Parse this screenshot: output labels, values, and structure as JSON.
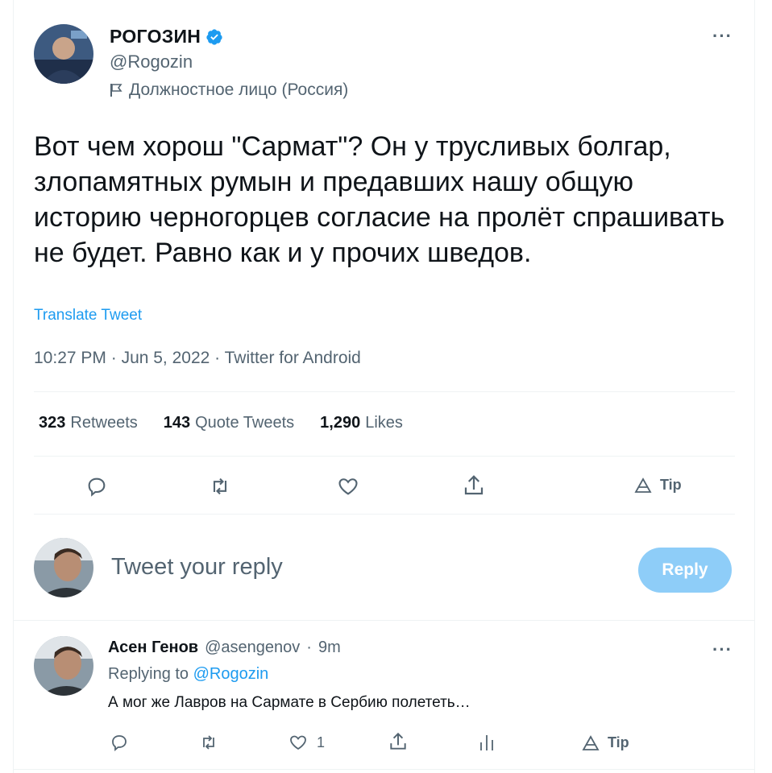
{
  "tweet": {
    "author_name": "РОГОЗИН",
    "author_handle": "@Rogozin",
    "label": "Должностное лицо (Россия)",
    "text": "Вот чем хорош \"Сармат\"? Он у трусливых болгар, злопамятных румын и предавших нашу общую историю черногорцев согласие на пролёт спрашивать не будет. Равно как и у прочих шведов.",
    "translate_label": "Translate Tweet",
    "time": "10:27 PM",
    "date": "Jun 5, 2022",
    "source": "Twitter for Android",
    "separator": " · ",
    "stats": {
      "retweets_count": "323",
      "retweets_label": "Retweets",
      "quote_count": "143",
      "quote_label": "Quote Tweets",
      "likes_count": "1,290",
      "likes_label": "Likes"
    },
    "actions": {
      "tip_label": "Tip"
    }
  },
  "compose": {
    "placeholder": "Tweet your reply",
    "button_label": "Reply"
  },
  "reply": {
    "author_name": "Асен Генов",
    "author_handle": "@asengenov",
    "time": "9m",
    "replying_prefix": "Replying to",
    "replying_to": "@Rogozin",
    "text": "А мог же Лавров на Сармате в Сербию полететь…",
    "like_count": "1",
    "tip_label": "Tip"
  },
  "icons": {
    "more": "more-icon",
    "verified": "verified-badge-icon",
    "flag": "flag-icon",
    "reply": "reply-icon",
    "retweet": "retweet-icon",
    "like": "heart-icon",
    "share": "share-icon",
    "tip": "tip-icon",
    "analytics": "analytics-icon"
  },
  "colors": {
    "accent": "#1d9bf0",
    "muted": "#536471",
    "reply_button_disabled": "#8ecdf8"
  }
}
